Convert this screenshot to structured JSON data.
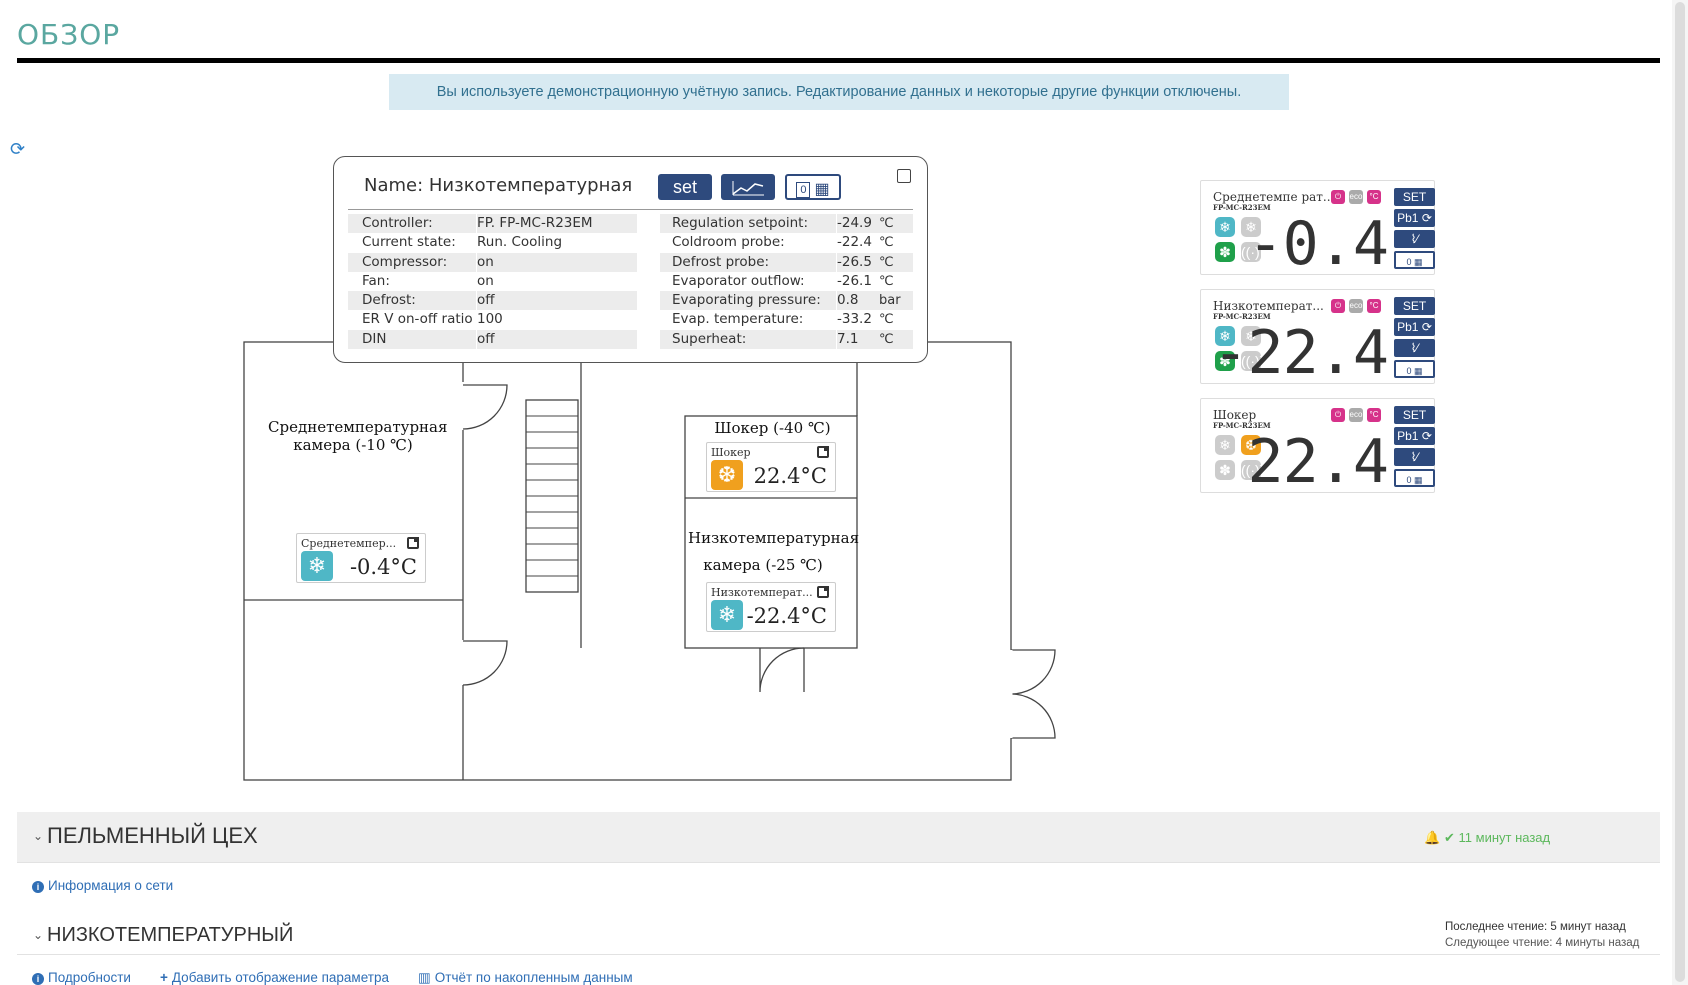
{
  "page": {
    "title": "ОБЗОР",
    "demo_notice": "Вы используете демонстрационную учётную запись. Редактирование данных и некоторые другие функции отключены."
  },
  "plan": {
    "room_medium": {
      "line1": "Среднетемпературная",
      "line2": "камера (-10 ℃)"
    },
    "room_shocker": "Шокер (-40 ℃)",
    "room_low": {
      "line1": "Низкотемпературная",
      "line2": "камера (-25 ℃)"
    },
    "sensors": [
      {
        "name": "Среднетемпер...",
        "temp": "-0.4°C",
        "color": "#4fb7c6",
        "icon": "snowflake-icon"
      },
      {
        "name": "Шокер",
        "temp": "22.4°C",
        "color": "#f0a01e",
        "icon": "snowflake-sun-icon"
      },
      {
        "name": "Низкотемперат...",
        "temp": "-22.4°C",
        "color": "#4fb7c6",
        "icon": "snowflake-icon"
      }
    ]
  },
  "popup": {
    "name": "Name: Низкотемпературная",
    "set_label": "set",
    "calendar_count": "0",
    "left_rows": [
      {
        "k": "Controller:",
        "v": "FP. FP-MC-R23EM"
      },
      {
        "k": "Current state:",
        "v": "Run. Cooling"
      },
      {
        "k": "Compressor:",
        "v": "on"
      },
      {
        "k": "Fan:",
        "v": "on"
      },
      {
        "k": "Defrost:",
        "v": "off"
      },
      {
        "k": "ER V on-off ratio",
        "v": "100"
      },
      {
        "k": "DIN",
        "v": "off"
      }
    ],
    "right_rows": [
      {
        "k": "Regulation setpoint:",
        "v": "-24.9",
        "u": "℃"
      },
      {
        "k": "Coldroom probe:",
        "v": "-22.4",
        "u": "℃"
      },
      {
        "k": "Defrost probe:",
        "v": "-26.5",
        "u": "℃"
      },
      {
        "k": "Evaporator outflow:",
        "v": "-26.1",
        "u": "℃"
      },
      {
        "k": "Evaporating pressure:",
        "v": "0.8",
        "u": "bar"
      },
      {
        "k": "Evap. temperature:",
        "v": "-33.2",
        "u": "℃"
      },
      {
        "k": "Superheat:",
        "v": "7.1",
        "u": "℃"
      }
    ]
  },
  "devices": [
    {
      "name": "Среднетемпе рат...",
      "model": "FP-MC-R23EM",
      "value": "-0.4",
      "set": "SET",
      "pb": "Pb1",
      "cal": "0",
      "icons": [
        "snowflake-blue",
        "snowflake-grey",
        "fan-green",
        "defrost-grey"
      ]
    },
    {
      "name": "Низкотемперат...",
      "model": "FP-MC-R23EM",
      "value": "-22.4",
      "set": "SET",
      "pb": "Pb1",
      "cal": "0",
      "icons": [
        "snowflake-blue",
        "snowflake-grey",
        "fan-green",
        "defrost-grey"
      ]
    },
    {
      "name": "Шокер",
      "model": "FP-MC-R23EM",
      "value": "22.4",
      "set": "SET",
      "pb": "Pb1",
      "cal": "0",
      "icons": [
        "snowflake-grey",
        "sun-orange",
        "fan-grey",
        "defrost-grey"
      ]
    }
  ],
  "device_indicators": {
    "eco": "eco",
    "celsius": "°C"
  },
  "section1": {
    "title": "ПЕЛЬМЕННЫЙ ЦЕХ",
    "ago": "11 минут назад",
    "network_link": "Информация о сети"
  },
  "section2": {
    "title": "НИЗКОТЕМПЕРАТУРНЫЙ",
    "last_read": "Последнее чтение: 5 минут назад",
    "next_read": "Следующее чтение: 4 минуты назад",
    "links": [
      "Подробности",
      "Добавить отображение параметра",
      "Отчёт по накопленным данным"
    ]
  },
  "colors": {
    "accent": "#5aa7a0",
    "button": "#2e4a7d",
    "link": "#2f6eb5",
    "cold": "#4fb7c6",
    "warm": "#f0a01e",
    "fan": "#1fa04a"
  }
}
